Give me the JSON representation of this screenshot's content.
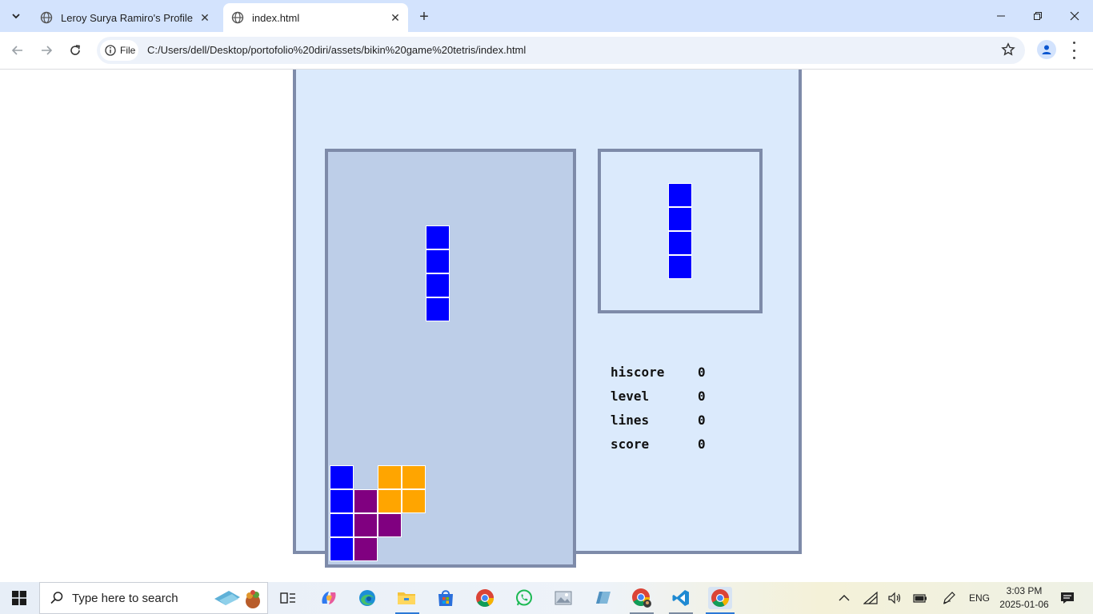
{
  "browser": {
    "tabs": [
      {
        "title": "Leroy Surya Ramiro's Profile",
        "active": false
      },
      {
        "title": "index.html",
        "active": true
      }
    ],
    "site_info_label": "File",
    "url": "C:/Users/dell/Desktop/portofolio%20diri/assets/bikin%20game%20tetris/index.html"
  },
  "game": {
    "colors": {
      "I": "#0000ff",
      "O": "#ffa500",
      "T": "#800080"
    },
    "stats": [
      {
        "label": "hiscore",
        "value": "0"
      },
      {
        "label": "level",
        "value": "0"
      },
      {
        "label": "lines",
        "value": "0"
      },
      {
        "label": "score",
        "value": "0"
      }
    ]
  },
  "taskbar": {
    "search_placeholder": "Type here to search",
    "language": "ENG",
    "time": "3:03 PM",
    "date": "2025-01-06"
  }
}
